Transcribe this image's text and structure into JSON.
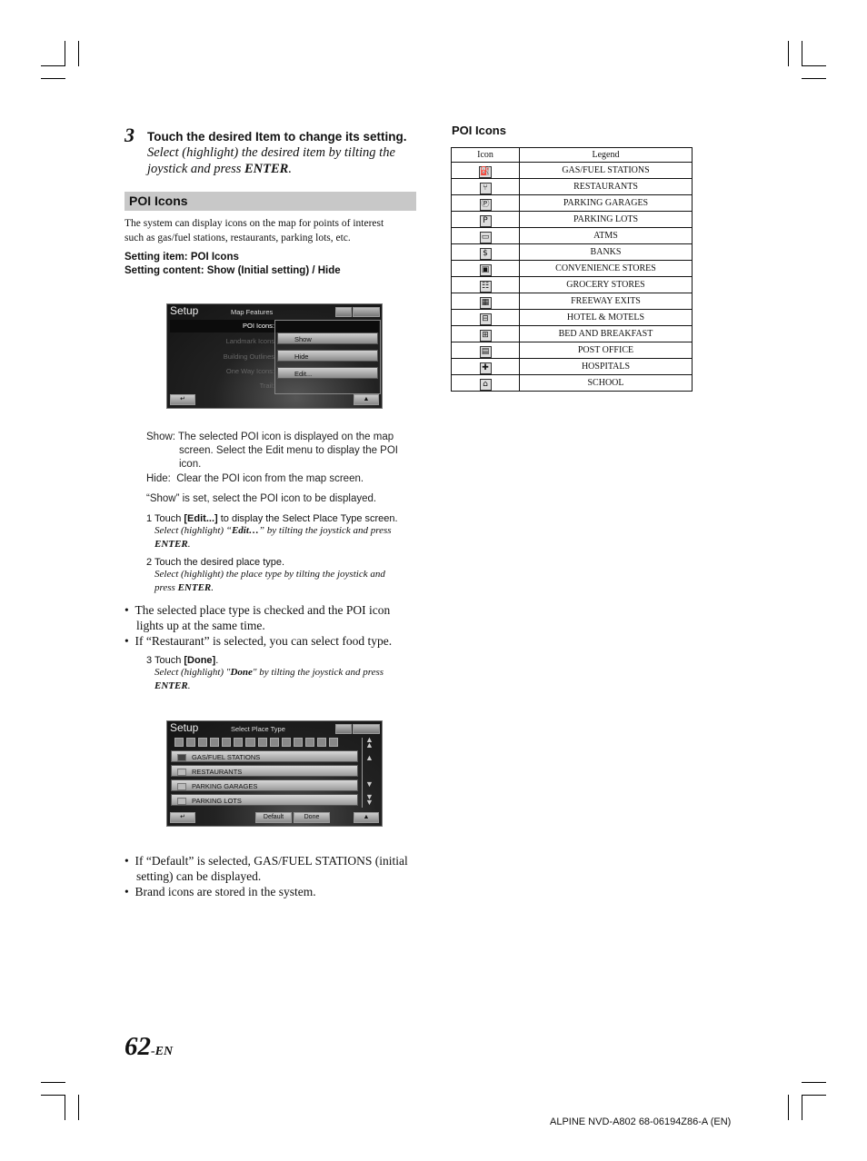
{
  "step3": {
    "number": "3",
    "title": "Touch the desired Item to change its setting.",
    "subtitle_line1": "Select (highlight) the desired item by tilting the",
    "subtitle_line2_pre": "joystick and press ",
    "subtitle_enter": "ENTER",
    "subtitle_end": "."
  },
  "section": {
    "title": "POI Icons",
    "intro_line1": "The system can display icons on the map for points of interest",
    "intro_line2": "such as gas/fuel stations, restaurants, parking lots, etc.",
    "setting_item": "Setting item: POI Icons",
    "setting_content": "Setting content: Show (Initial setting) / Hide"
  },
  "screen1": {
    "title": "Setup",
    "subtitle": "Map Features",
    "menu_items": [
      "POI Icons:",
      "Landmark Icons",
      "Building Outlines",
      "One Way Icons:",
      "Trail:"
    ],
    "options": [
      "Show",
      "Hide",
      "Edit..."
    ],
    "back_icon": "back-icon",
    "up_icon": "up-arrow-icon"
  },
  "descriptions": {
    "show_label": "Show:",
    "show_text1": "The selected POI icon is displayed on the map",
    "show_text2": "screen. Select the Edit menu to display the POI",
    "show_text3": "icon.",
    "hide_label": "Hide:",
    "hide_text": "Clear the POI icon from the map screen.",
    "show_set": "“Show” is set, select the POI icon to be displayed."
  },
  "instructions": [
    {
      "pre": "1 Touch ",
      "bold": "[Edit...]",
      "post": " to display the Select Place Type screen.",
      "sub1": "Select (highlight) “",
      "sub_bold": "Edit…",
      "sub2": "” by tilting the joystick and press",
      "enter": "ENTER"
    },
    {
      "pre": "2 Touch the desired place type.",
      "sub1": "Select (highlight) the place type by tilting the joystick and",
      "sub2": "press ",
      "enter": "ENTER"
    },
    {
      "pre": "3 Touch ",
      "bold": "[Done]",
      "post": ".",
      "sub1": "Select (highlight) \"",
      "sub_bold": "Done",
      "sub2": "\" by tilting the joystick and press",
      "enter": "ENTER"
    }
  ],
  "bullets_mid": [
    "The selected place type is checked and the POI icon",
    "lights up at the same time.",
    "If “Restaurant” is selected, you can select food type."
  ],
  "screen2": {
    "title": "Setup",
    "subtitle": "Select Place Type",
    "icon_strip": [
      "gas",
      "restaurant",
      "garage",
      "parking",
      "atm",
      "bank",
      "convenience",
      "grocery",
      "exit",
      "hotel",
      "bnb",
      "post",
      "hospital",
      "school"
    ],
    "rows": [
      "GAS/FUEL STATIONS",
      "RESTAURANTS",
      "PARKING GARAGES",
      "PARKING LOTS"
    ],
    "default_label": "Default",
    "done_label": "Done"
  },
  "bullets_end": [
    "If “Default” is selected, GAS/FUEL STATIONS (initial",
    "setting) can be displayed.",
    "Brand icons are stored in the system."
  ],
  "poi_table": {
    "title": "POI Icons",
    "headers": [
      "Icon",
      "Legend"
    ],
    "rows": [
      {
        "icon": "gas-pump-icon",
        "glyph": "⛽",
        "legend": "GAS/FUEL STATIONS"
      },
      {
        "icon": "restaurant-icon",
        "glyph": "⑂",
        "legend": "RESTAURANTS"
      },
      {
        "icon": "parking-garage-icon",
        "glyph": "Ⓟ",
        "legend": "PARKING GARAGES"
      },
      {
        "icon": "parking-lot-icon",
        "glyph": "P",
        "legend": "PARKING LOTS"
      },
      {
        "icon": "atm-icon",
        "glyph": "▭",
        "legend": "ATMS"
      },
      {
        "icon": "bank-icon",
        "glyph": "$",
        "legend": "BANKS"
      },
      {
        "icon": "convenience-store-icon",
        "glyph": "▣",
        "legend": "CONVENIENCE STORES"
      },
      {
        "icon": "grocery-cart-icon",
        "glyph": "☷",
        "legend": "GROCERY STORES"
      },
      {
        "icon": "freeway-exit-icon",
        "glyph": "▦",
        "legend": "FREEWAY EXITS"
      },
      {
        "icon": "hotel-bed-icon",
        "glyph": "⊟",
        "legend": "HOTEL & MOTELS"
      },
      {
        "icon": "bed-breakfast-icon",
        "glyph": "⊞",
        "legend": "BED AND BREAKFAST"
      },
      {
        "icon": "post-office-icon",
        "glyph": "▤",
        "legend": "POST OFFICE"
      },
      {
        "icon": "hospital-cross-icon",
        "glyph": "✚",
        "legend": "HOSPITALS"
      },
      {
        "icon": "school-icon",
        "glyph": "⌂",
        "legend": "SCHOOL"
      }
    ]
  },
  "footer": {
    "page_number": "62",
    "page_suffix": "-EN",
    "doc_id": "ALPINE NVD-A802 68-06194Z86-A (EN)"
  }
}
